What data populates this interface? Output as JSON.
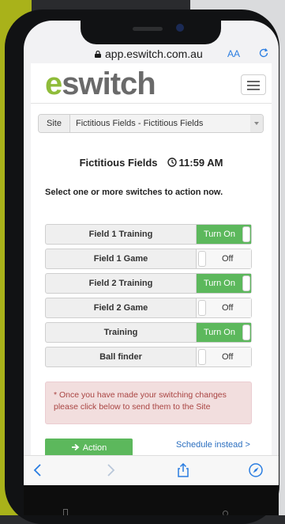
{
  "browser": {
    "url": "app.eswitch.com.au",
    "text_size_label": "AA"
  },
  "header": {
    "logo_e": "e",
    "logo_rest": "switch"
  },
  "site": {
    "label": "Site",
    "selected": "Fictitious Fields - Fictitious Fields"
  },
  "status": {
    "location": "Fictitious Fields",
    "time": "11:59 AM"
  },
  "instructions": "Select one or more switches to action now.",
  "switches": [
    {
      "name": "Field 1 Training",
      "state": "Turn On"
    },
    {
      "name": "Field 1 Game",
      "state": "Off"
    },
    {
      "name": "Field 2 Training",
      "state": "Turn On"
    },
    {
      "name": "Field 2 Game",
      "state": "Off"
    },
    {
      "name": "Training",
      "state": "Turn On"
    },
    {
      "name": "Ball finder",
      "state": "Off"
    }
  ],
  "alert": {
    "text": "* Once you have made your switching changes please click below to send them to the Site"
  },
  "actions": {
    "action_label": "Action",
    "schedule_label": "Schedule instead >"
  },
  "colors": {
    "on": "#5cb85c",
    "logo_green": "#8fbc3a",
    "link": "#2a6ebf",
    "alert_text": "#a94442"
  }
}
